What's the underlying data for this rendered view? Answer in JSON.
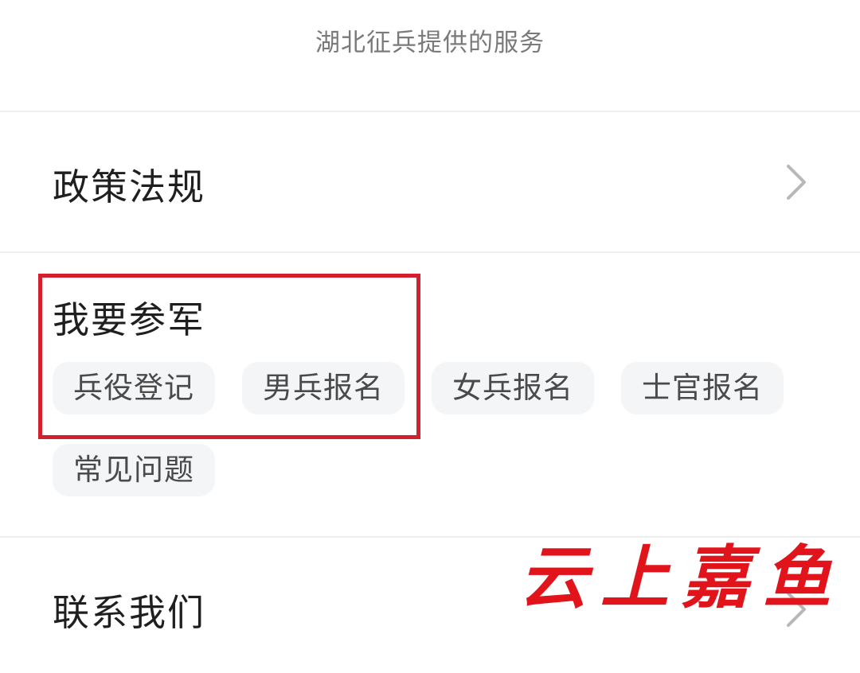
{
  "header": {
    "subtitle": "湖北征兵提供的服务"
  },
  "menu": {
    "policy": {
      "label": "政策法规",
      "chevron_icon": "chevron-right-icon"
    },
    "join": {
      "title": "我要参军",
      "chips": [
        {
          "label": "兵役登记"
        },
        {
          "label": "男兵报名"
        },
        {
          "label": "女兵报名"
        },
        {
          "label": "士官报名"
        },
        {
          "label": "常见问题"
        }
      ]
    },
    "contact": {
      "label": "联系我们",
      "chevron_icon": "chevron-right-icon"
    }
  },
  "annotation": {
    "highlight_color": "#d3202f"
  },
  "watermark": {
    "text": "云上嘉鱼",
    "color": "#e1141c"
  },
  "colors": {
    "background": "#ffffff",
    "divider": "#eeeeee",
    "chip_background": "#f4f5f7",
    "chevron": "#b8b8b8"
  }
}
